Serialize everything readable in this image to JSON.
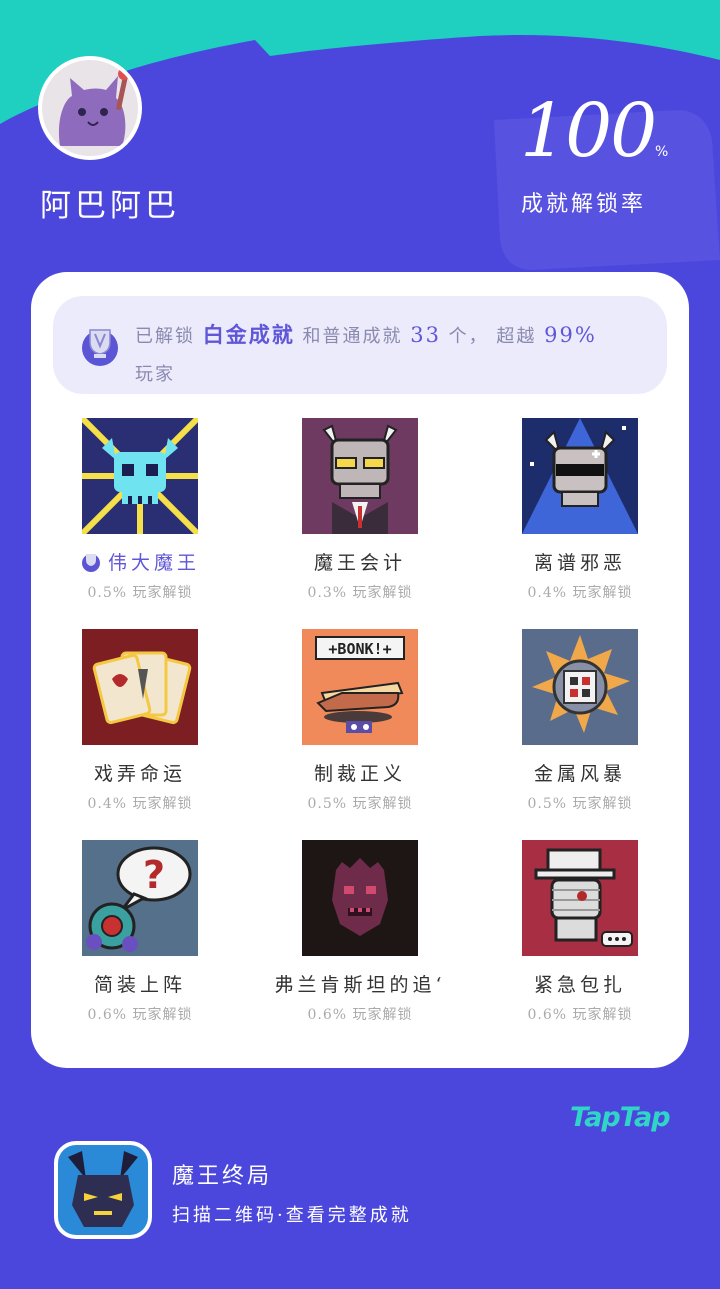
{
  "profile": {
    "username": "阿巴阿巴",
    "avatar_icon": "cat-avatar"
  },
  "stats": {
    "percent": "100",
    "percent_sign": "%",
    "percent_label": "成就解锁率"
  },
  "banner": {
    "icon": "platinum-trophy-icon",
    "prefix": "已解锁",
    "highlight": "白金成就",
    "middle": "和普通成就",
    "count": "33",
    "unit": "个，",
    "beyond": "超越",
    "beyond_pct": "99%",
    "suffix": "玩家"
  },
  "achievements": [
    {
      "name": "伟大魔王",
      "rate": "0.5% 玩家解锁",
      "platinum": true,
      "icon": "glowing-skull-icon"
    },
    {
      "name": "魔王会计",
      "rate": "0.3% 玩家解锁",
      "platinum": false,
      "icon": "skull-accountant-icon"
    },
    {
      "name": "离谱邪恶",
      "rate": "0.4% 玩家解锁",
      "platinum": false,
      "icon": "sunglasses-skull-icon"
    },
    {
      "name": "戏弄命运",
      "rate": "0.4% 玩家解锁",
      "platinum": false,
      "icon": "cards-icon"
    },
    {
      "name": "制裁正义",
      "rate": "0.5% 玩家解锁",
      "platinum": false,
      "icon": "bonk-hat-icon"
    },
    {
      "name": "金属风暴",
      "rate": "0.5% 玩家解锁",
      "platinum": false,
      "icon": "metal-storm-icon"
    },
    {
      "name": "简装上阵",
      "rate": "0.6% 玩家解锁",
      "platinum": false,
      "icon": "question-bubble-icon"
    },
    {
      "name": "弗兰肯斯坦的追‘",
      "rate": "0.6% 玩家解锁",
      "platinum": false,
      "icon": "monster-face-icon"
    },
    {
      "name": "紧急包扎",
      "rate": "0.6% 玩家解锁",
      "platinum": false,
      "icon": "mummy-hat-icon"
    }
  ],
  "footer": {
    "brand": "TapTap",
    "game_name": "魔王终局",
    "hint": "扫描二维码·查看完整成就",
    "game_icon": "demon-king-icon"
  },
  "colors": {
    "background": "#4c47dc",
    "teal": "#2fd6c8",
    "accent": "#6056d8"
  }
}
